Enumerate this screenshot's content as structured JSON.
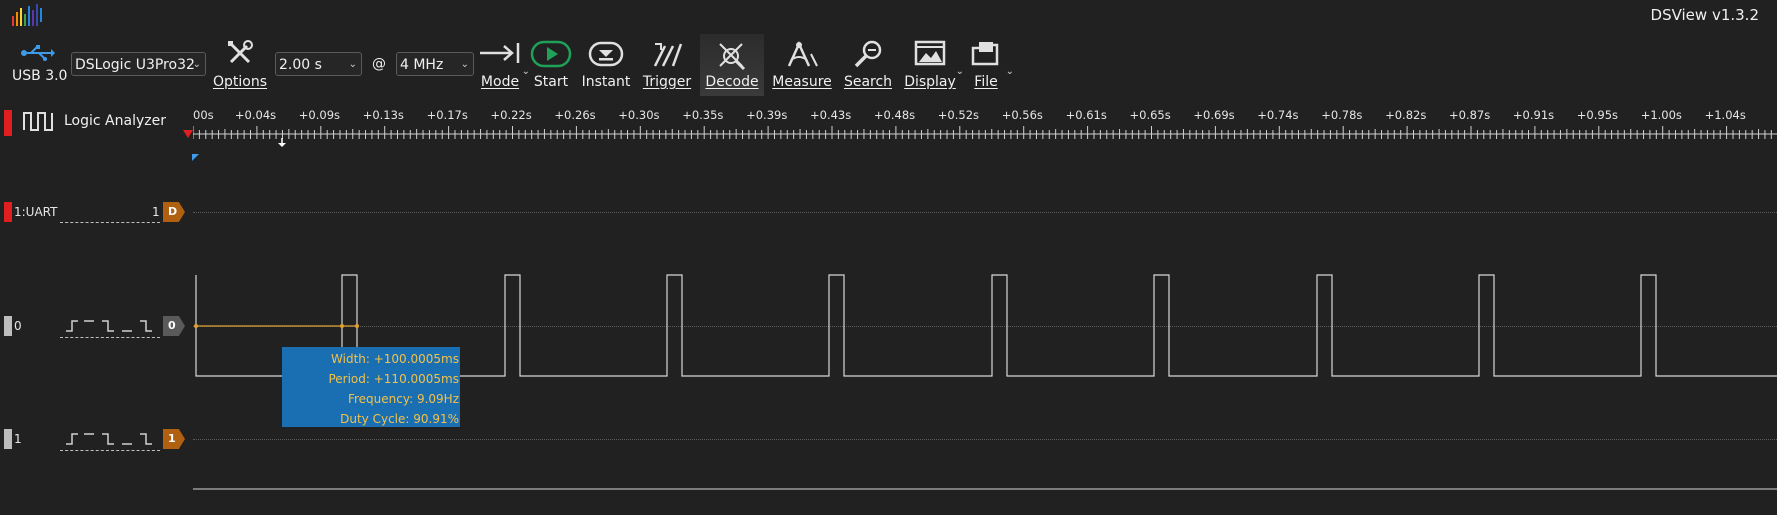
{
  "app": {
    "title": "DSView v1.3.2"
  },
  "toolbar": {
    "usb_label": "USB 3.0",
    "device": "DSLogic U3Pro32",
    "options_label": "Options",
    "duration": "2.00 s",
    "at": "@",
    "samplerate": "4 MHz",
    "mode_label": "Mode",
    "start_label": "Start",
    "instant_label": "Instant",
    "trigger_label": "Trigger",
    "decode_label": "Decode",
    "measure_label": "Measure",
    "search_label": "Search",
    "display_label": "Display",
    "file_label": "File"
  },
  "panel": {
    "mode_name": "Logic Analyzer"
  },
  "ruler": {
    "ticks": [
      "00s",
      "+0.04s",
      "+0.09s",
      "+0.13s",
      "+0.17s",
      "+0.22s",
      "+0.26s",
      "+0.30s",
      "+0.35s",
      "+0.39s",
      "+0.43s",
      "+0.48s",
      "+0.52s",
      "+0.56s",
      "+0.61s",
      "+0.65s",
      "+0.69s",
      "+0.74s",
      "+0.78s",
      "+0.82s",
      "+0.87s",
      "+0.91s",
      "+0.95s",
      "+1.00s",
      "+1.04s"
    ]
  },
  "channels": [
    {
      "name": "1:UART",
      "index": "1",
      "tag": "D",
      "color": "#e02020",
      "tag_color": "#b06010"
    },
    {
      "name": "0",
      "index": "",
      "tag": "0",
      "color": "#bdbdbd",
      "tag_color": "#5a5a5a"
    },
    {
      "name": "1",
      "index": "",
      "tag": "1",
      "color": "#bdbdbd",
      "tag_color": "#b06010"
    }
  ],
  "measure": {
    "width": "Width: +100.0005ms",
    "period": "Period: +110.0005ms",
    "frequency": "Frequency: 9.09Hz",
    "duty": "Duty Cycle: 90.91%"
  },
  "colors": {
    "accent_blue": "#1a6fb3",
    "start_green": "#1fa15a",
    "measure_text": "#f2c14a",
    "cursor_line": "#e0a030"
  }
}
